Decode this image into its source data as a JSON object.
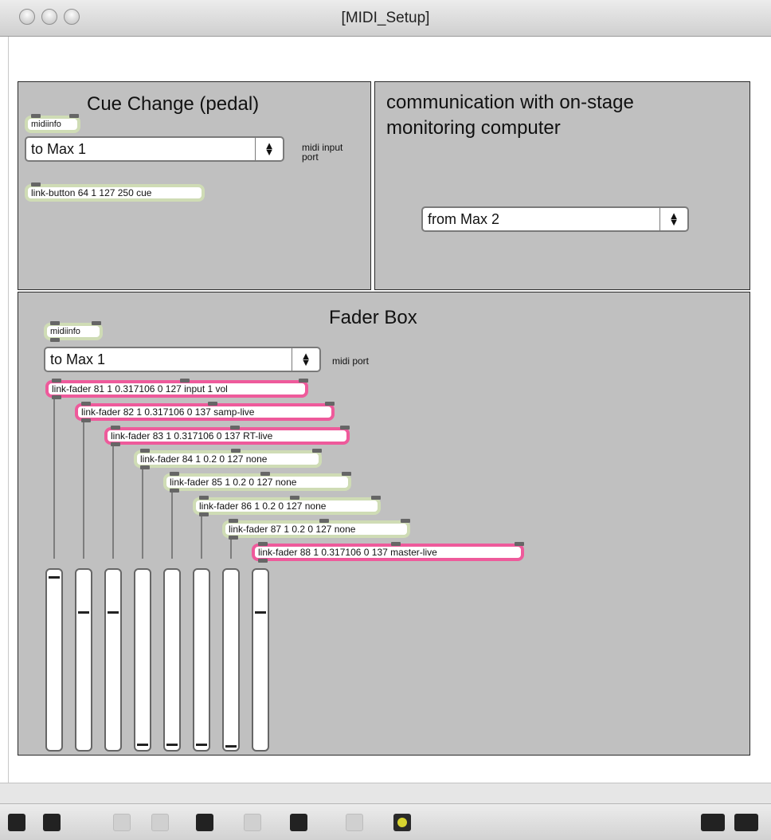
{
  "window": {
    "title": "[MIDI_Setup]"
  },
  "cue_panel": {
    "title": "Cue Change (pedal)",
    "midiinfo": "midiinfo",
    "menu_value": "to Max 1",
    "port_label": "midi input\nport",
    "button_obj": "link-button 64 1 127 250 cue"
  },
  "comm_panel": {
    "title": "communication with on-stage\nmonitoring computer",
    "menu_value": "from Max 2"
  },
  "fader_panel": {
    "title": "Fader Box",
    "midiinfo": "midiinfo",
    "menu_value": "to Max 1",
    "port_label": "midi port",
    "faders": [
      {
        "label": "link-fader 81 1 0.317106 0 127 input 1 vol",
        "active": true,
        "level": 0.98
      },
      {
        "label": "link-fader 82 1 0.317106 0 137 samp-live",
        "active": true,
        "level": 0.78
      },
      {
        "label": "link-fader 83 1 0.317106 0 137 RT-live",
        "active": true,
        "level": 0.78
      },
      {
        "label": "link-fader 84 1 0.2 0 127 none",
        "active": false,
        "level": 0.02
      },
      {
        "label": "link-fader 85 1 0.2 0 127 none",
        "active": false,
        "level": 0.02
      },
      {
        "label": "link-fader 86 1 0.2 0 127 none",
        "active": false,
        "level": 0.02
      },
      {
        "label": "link-fader 87 1 0.2 0 127 none",
        "active": false,
        "level": 0.01
      },
      {
        "label": "link-fader 88 1 0.317106 0 137 master-live",
        "active": true,
        "level": 0.78
      }
    ]
  },
  "toolbar": {
    "buttons": [
      "lock-icon",
      "presentation-icon",
      "patchcord-icon",
      "delete-icon",
      "debug-icon",
      "info-icon",
      "inspector-icon",
      "grid-icon",
      "edit-icon",
      "split-icon",
      "window-icon"
    ]
  }
}
